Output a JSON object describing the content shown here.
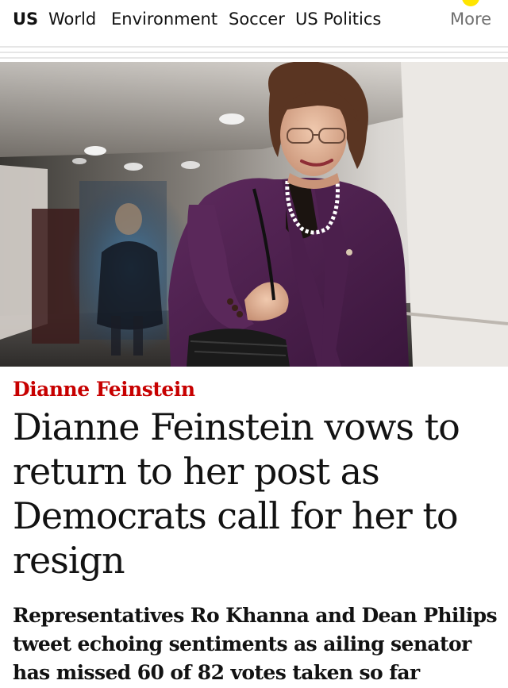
{
  "nav": {
    "items": [
      "US",
      "World",
      "Environment",
      "Soccer",
      "US Politics"
    ],
    "more_label": "More",
    "accent": "#ffe500"
  },
  "article": {
    "image_alt": "Dianne Feinstein smiling in a purple suit and pearl necklace, walking down a corridor",
    "info_icon": "info-icon",
    "kicker": "Dianne Feinstein",
    "kicker_color": "#c70000",
    "headline": "Dianne Feinstein vows to return to her post as Democrats call for her to resign",
    "standfirst": "Representatives Ro Khanna and Dean Philips tweet echoing sentiments as ailing senator has missed 60 of 82 votes taken so far"
  }
}
